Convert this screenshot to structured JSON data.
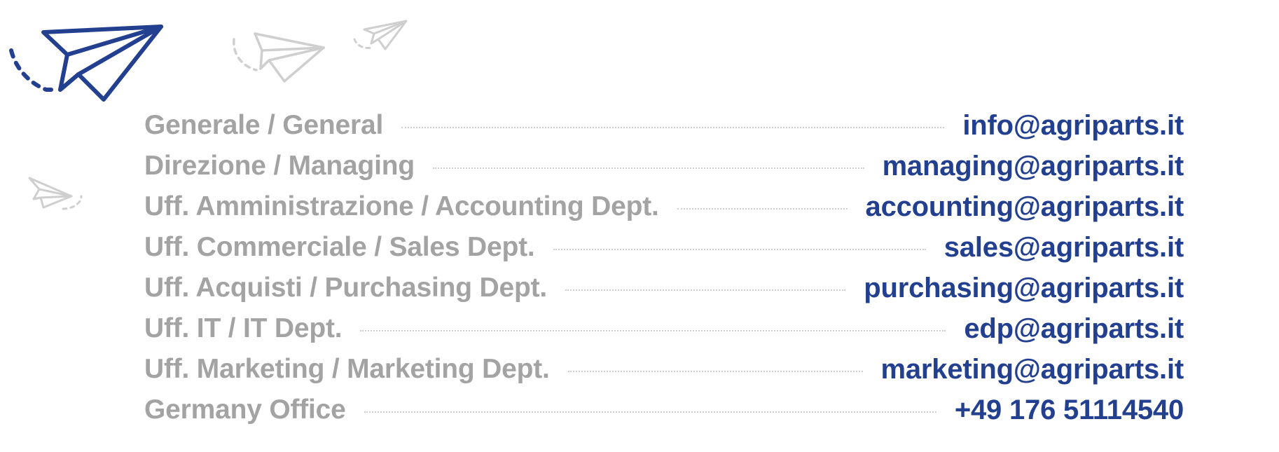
{
  "colors": {
    "label": "#a3a3a3",
    "value": "#233f8f",
    "plane_main": "#233f8f",
    "plane_faint": "#cfcfcf"
  },
  "icons": [
    "paper-plane-main-icon",
    "paper-plane-faint-icon",
    "paper-plane-small-icon",
    "paper-plane-left-icon"
  ],
  "contacts": [
    {
      "label": "Generale / General",
      "value": "info@agriparts.it"
    },
    {
      "label": "Direzione / Managing",
      "value": "managing@agriparts.it"
    },
    {
      "label": "Uff. Amministrazione / Accounting Dept.",
      "value": "accounting@agriparts.it"
    },
    {
      "label": "Uff. Commerciale / Sales Dept.",
      "value": "sales@agriparts.it"
    },
    {
      "label": "Uff. Acquisti / Purchasing Dept.",
      "value": "purchasing@agriparts.it"
    },
    {
      "label": "Uff. IT / IT Dept.",
      "value": "edp@agriparts.it"
    },
    {
      "label": "Uff. Marketing / Marketing Dept.",
      "value": "marketing@agriparts.it"
    },
    {
      "label": "Germany Office",
      "value": "+49 176 51114540"
    }
  ]
}
